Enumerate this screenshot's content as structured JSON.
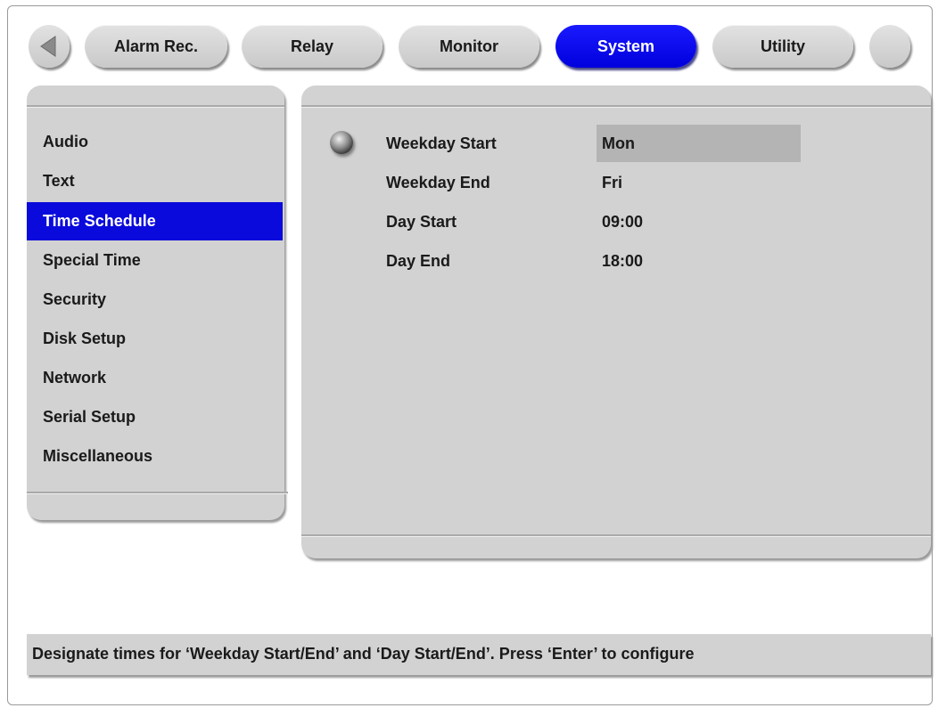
{
  "tabs": [
    {
      "label": "Alarm Rec."
    },
    {
      "label": "Relay"
    },
    {
      "label": "Monitor"
    },
    {
      "label": "System"
    },
    {
      "label": "Utility"
    }
  ],
  "active_tab": "System",
  "menu": {
    "items": [
      {
        "label": "Audio"
      },
      {
        "label": "Text"
      },
      {
        "label": "Time Schedule"
      },
      {
        "label": "Special Time"
      },
      {
        "label": "Security"
      },
      {
        "label": "Disk Setup"
      },
      {
        "label": "Network"
      },
      {
        "label": "Serial Setup"
      },
      {
        "label": "Miscellaneous"
      }
    ],
    "selected": "Time Schedule"
  },
  "settings": [
    {
      "label": "Weekday Start",
      "value": "Mon"
    },
    {
      "label": "Weekday End",
      "value": "Fri"
    },
    {
      "label": "Day Start",
      "value": "09:00"
    },
    {
      "label": "Day End",
      "value": "18:00"
    }
  ],
  "status": {
    "text": "Designate times for ‘Weekday Start/End’ and ‘Day Start/End’. Press ‘Enter’ to configure"
  },
  "colors": {
    "accent": "#0000dd",
    "panel": "#d2d2d2",
    "focus": "#b4b4b4"
  }
}
